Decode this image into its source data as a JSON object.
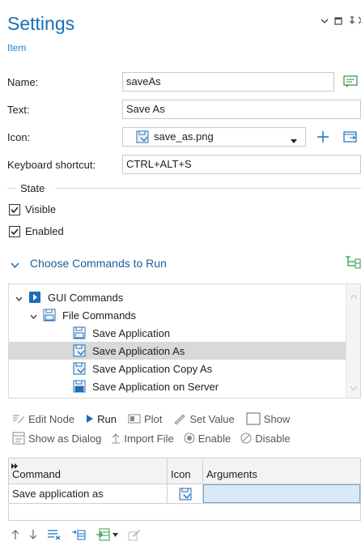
{
  "header": {
    "title": "Settings",
    "subtitle": "Item"
  },
  "form": {
    "name_label": "Name:",
    "name_value": "saveAs",
    "text_label": "Text:",
    "text_value": "Save As",
    "icon_label": "Icon:",
    "icon_value": "save_as.png",
    "shortcut_label": "Keyboard shortcut:",
    "shortcut_value": "CTRL+ALT+S"
  },
  "state": {
    "group_label": "State",
    "visible_label": "Visible",
    "visible_checked": true,
    "enabled_label": "Enabled",
    "enabled_checked": true
  },
  "commands": {
    "section_title": "Choose Commands to Run",
    "tree": [
      {
        "label": "GUI Commands",
        "level": 0,
        "icon": "gui-commands-icon",
        "expanded": true
      },
      {
        "label": "File Commands",
        "level": 1,
        "icon": "file-commands-icon",
        "expanded": true
      },
      {
        "label": "Save Application",
        "level": 2,
        "icon": "save-icon"
      },
      {
        "label": "Save Application As",
        "level": 2,
        "icon": "save-as-icon",
        "selected": true
      },
      {
        "label": "Save Application Copy As",
        "level": 2,
        "icon": "save-as-icon"
      },
      {
        "label": "Save Application on Server",
        "level": 2,
        "icon": "save-icon"
      }
    ]
  },
  "toolbar": {
    "edit_node": "Edit Node",
    "run": "Run",
    "plot": "Plot",
    "set_value": "Set Value",
    "show": "Show",
    "show_as_dialog": "Show as Dialog",
    "import_file": "Import File",
    "enable": "Enable",
    "disable": "Disable"
  },
  "grid": {
    "columns": [
      "Command",
      "Icon",
      "Arguments"
    ],
    "rows": [
      {
        "command": "Save application as",
        "icon": "save-as-icon",
        "arguments": ""
      }
    ]
  },
  "colors": {
    "accent": "#1b6fb5",
    "selection": "#d9d9d9",
    "arguments_cell": "#dbe9f7"
  }
}
